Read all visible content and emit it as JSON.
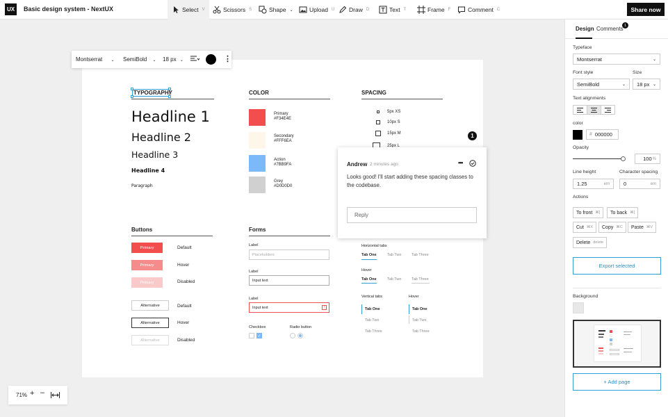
{
  "app": {
    "logo": "UX",
    "title": "Basic design system - NextUX",
    "share_label": "Share now"
  },
  "tools": [
    {
      "label": "Select",
      "key": "V",
      "icon": "cursor-icon"
    },
    {
      "label": "Scissors",
      "key": "S",
      "icon": "scissors-icon"
    },
    {
      "label": "Shape",
      "key": "",
      "icon": "shape-icon"
    },
    {
      "label": "Upload",
      "key": "U",
      "icon": "image-icon"
    },
    {
      "label": "Draw",
      "key": "D",
      "icon": "pen-icon"
    },
    {
      "label": "Text",
      "key": "T",
      "icon": "text-icon"
    },
    {
      "label": "Frame",
      "key": "F",
      "icon": "frame-icon"
    },
    {
      "label": "Comment",
      "key": "C",
      "icon": "comment-icon"
    }
  ],
  "text_toolbar": {
    "font": "Montserrat",
    "weight": "SemiBold",
    "size": "18 px"
  },
  "artboard": {
    "typography": {
      "title": "TYPOGRAPHY",
      "h1": "Headline 1",
      "h2": "Headline 2",
      "h3": "Headline 3",
      "h4": "Headline 4",
      "p": "Paragraph"
    },
    "color": {
      "title": "COLOR",
      "swatches": [
        {
          "name": "Primary",
          "hex": "#F34E4E"
        },
        {
          "name": "Secondary",
          "hex": "#FFF6EA"
        },
        {
          "name": "Action",
          "hex": "#7BB9FA"
        },
        {
          "name": "Grey",
          "hex": "#D0D0D0"
        }
      ]
    },
    "spacing": {
      "title": "SPACING",
      "rows": [
        "5px XS",
        "10px S",
        "15px M",
        "25px L"
      ]
    },
    "buttons": {
      "title": "Buttons",
      "primary_label": "Primary",
      "alternative_label": "Alternative",
      "states": [
        "Default",
        "Hover",
        "Disabled"
      ]
    },
    "forms": {
      "title": "Forms",
      "label": "Label",
      "placeholder": "Placeholders",
      "input_text": "Input text",
      "checkbox": "Checkbox",
      "radio": "Radio button"
    },
    "tabs": {
      "horizontal_title": "Horizontal tabs",
      "hover_title": "Hover",
      "vertical_title": "Vertical tabs",
      "vertical_hover_title": "Hover",
      "items": [
        "Tab One",
        "Tab Two",
        "Tab Three"
      ]
    }
  },
  "comment": {
    "badge": "1",
    "author": "Andrew",
    "time": "2 minutes ago",
    "body": "Looks good! I'll start adding these spacing classes to the codebase.",
    "reply_placeholder": "Reply",
    "more": "•••"
  },
  "zoom": {
    "value": "71%"
  },
  "panel": {
    "tab_design": "Design",
    "tab_comments": "Comments",
    "comments_count": "1",
    "typeface_label": "Typeface",
    "typeface": "Montserrat",
    "font_style_label": "Font style",
    "font_style": "SemiBold",
    "size_label": "Size",
    "size": "18 px",
    "alignments_label": "Text alignments",
    "color_label": "color",
    "color_hash": "#",
    "color_value": "000000",
    "opacity_label": "Opacity",
    "opacity_value": "100",
    "opacity_unit": "%",
    "opacity_level": 1.0,
    "line_height_label": "Line height",
    "line_height": "1.25",
    "line_height_unit": "em",
    "char_spacing_label": "Character spacing",
    "char_spacing": "0",
    "char_spacing_unit": "em",
    "actions_label": "Actions",
    "actions": [
      {
        "label": "To front",
        "kbd": "⌘]"
      },
      {
        "label": "To back",
        "kbd": "⌘["
      },
      {
        "label": "Cut",
        "kbd": "⌘X"
      },
      {
        "label": "Copy",
        "kbd": "⌘C"
      },
      {
        "label": "Paste",
        "kbd": "⌘V"
      },
      {
        "label": "Delete",
        "kbd": "delete"
      }
    ],
    "export_label": "Export selected",
    "background_label": "Background",
    "add_page_label": "+ Add page"
  }
}
